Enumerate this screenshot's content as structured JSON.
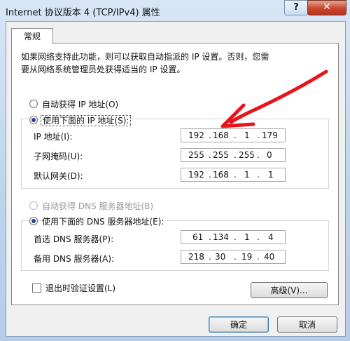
{
  "window": {
    "title": "Internet 协议版本 4 (TCP/IPv4) 属性",
    "help_label": "?",
    "close_label": "✕"
  },
  "tabs": [
    {
      "label": "常规",
      "selected": true
    }
  ],
  "description": "如果网络支持此功能，则可以获取自动指派的 IP 设置。否则，您需\n要从网络系统管理员处获得适当的 IP 设置。",
  "ip_mode": {
    "auto_label": "自动获得 IP 地址(O)",
    "manual_label": "使用下面的 IP 地址(S):",
    "selected": "manual"
  },
  "ip_fields": [
    {
      "label": "IP 地址(I):",
      "octets": [
        "192",
        "168",
        "1",
        "179"
      ]
    },
    {
      "label": "子网掩码(U):",
      "octets": [
        "255",
        "255",
        "255",
        "0"
      ]
    },
    {
      "label": "默认网关(D):",
      "octets": [
        "192",
        "168",
        "1",
        "1"
      ]
    }
  ],
  "dns_mode": {
    "auto_label": "自动获得 DNS 服务器地址(B)",
    "manual_label": "使用下面的 DNS 服务器地址(E):",
    "selected": "manual"
  },
  "dns_fields": [
    {
      "label": "首选 DNS 服务器(P):",
      "octets": [
        "61",
        "134",
        "1",
        "4"
      ]
    },
    {
      "label": "备用 DNS 服务器(A):",
      "octets": [
        "218",
        "30",
        "19",
        "40"
      ]
    }
  ],
  "validate_on_exit": {
    "label": "退出时验证设置(L)",
    "checked": false
  },
  "buttons": {
    "advanced": "高级(V)...",
    "ok": "确定",
    "cancel": "取消"
  },
  "annotation": {
    "arrow_color": "#e8141b"
  },
  "colors": {
    "accent": "#3c7fb1",
    "radio_dot": "#1f3fa0"
  }
}
